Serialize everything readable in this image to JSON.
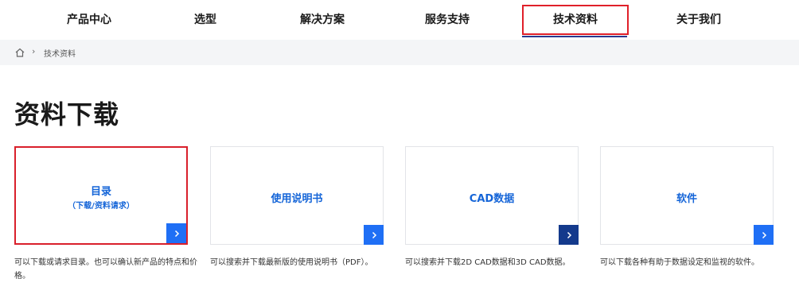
{
  "nav": {
    "items": [
      {
        "label": "产品中心"
      },
      {
        "label": "选型"
      },
      {
        "label": "解决方案"
      },
      {
        "label": "服务支持"
      },
      {
        "label": "技术资料"
      },
      {
        "label": "关于我们"
      }
    ]
  },
  "breadcrumb": {
    "home_icon": "home-icon",
    "separator": "›",
    "current": "技术资料"
  },
  "page": {
    "title": "资料下载"
  },
  "cards": [
    {
      "title": "目录",
      "subtitle": "（下载/资料请求）",
      "description": "可以下载或请求目录。也可以确认新产品的特点和价格。"
    },
    {
      "title": "使用说明书",
      "description": "可以搜索并下载最新版的使用说明书（PDF）。"
    },
    {
      "title": "CAD数据",
      "description": "可以搜索并下载2D CAD数据和3D CAD数据。"
    },
    {
      "title": "软件",
      "description": "可以下载各种有助于数据设定和监视的软件。"
    }
  ],
  "colors": {
    "accent": "#1565d8",
    "arrow": "#1f6ff5",
    "arrow_dark": "#143a8c",
    "highlight": "#d9202b",
    "nav_underline": "#2b3a8f"
  }
}
